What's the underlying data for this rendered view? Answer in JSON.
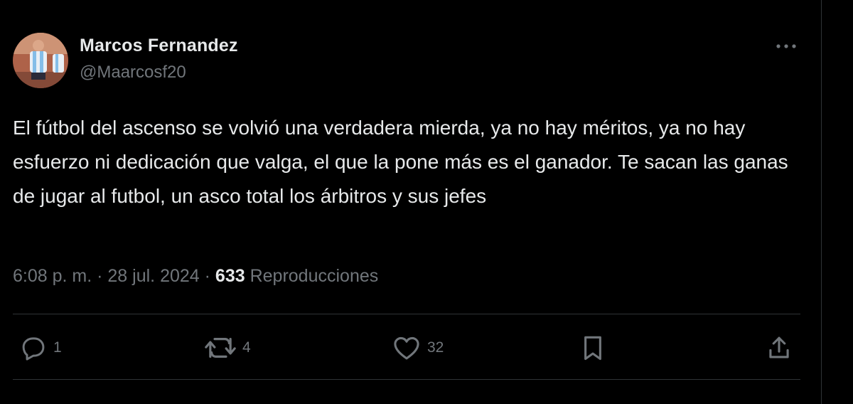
{
  "author": {
    "display_name": "Marcos Fernandez",
    "handle": "@Maarcosf20",
    "avatar_icon": "avatar-photo"
  },
  "menu": {
    "icon": "more-horizontal-icon"
  },
  "tweet": {
    "text": "El fútbol del ascenso se volvió una verdadera mierda, ya no hay méritos, ya no hay esfuerzo ni dedicación que valga, el que la pone más es el ganador. Te sacan las ganas de jugar al futbol, un asco total los árbitros y sus jefes"
  },
  "meta": {
    "time": "6:08 p. m.",
    "separator": "·",
    "date": "28 jul. 2024",
    "views_count": "633",
    "views_label": "Reproducciones"
  },
  "actions": {
    "replies": {
      "icon": "reply-icon",
      "count": "1"
    },
    "reposts": {
      "icon": "repost-icon",
      "count": "4"
    },
    "likes": {
      "icon": "heart-icon",
      "count": "32"
    },
    "bookmark": {
      "icon": "bookmark-icon"
    },
    "share": {
      "icon": "share-icon"
    }
  },
  "colors": {
    "background": "#000000",
    "text_primary": "#e7e9ea",
    "text_secondary": "#71767b",
    "divider": "#2f3336"
  }
}
